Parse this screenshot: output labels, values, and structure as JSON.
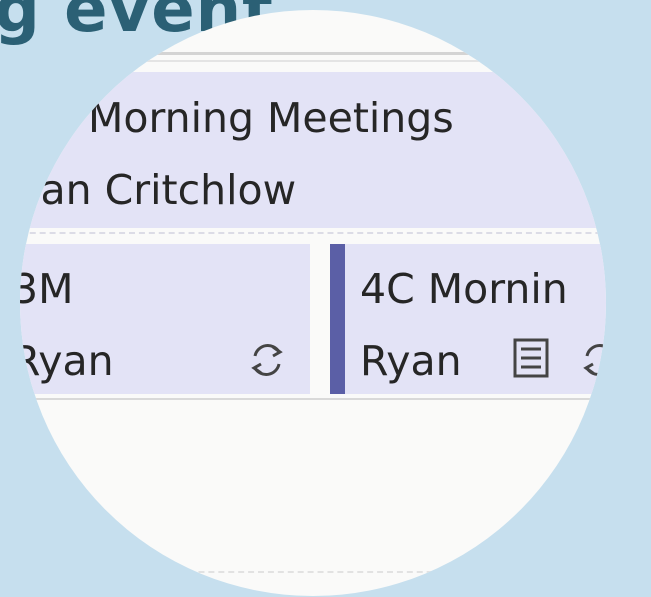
{
  "page": {
    "heading": "g event"
  },
  "calendar": {
    "top_event": {
      "title": "Morning Meetings",
      "organizer": "Ryan Critchlow"
    },
    "left_event": {
      "title": "3M",
      "organizer": "Ryan",
      "icon": "recurring-icon"
    },
    "right_event": {
      "title": "4C Mornin",
      "organizer": "Ryan",
      "icons": [
        "notes-icon",
        "recurring-icon"
      ]
    }
  },
  "colors": {
    "background": "#c6dfee",
    "heading": "#2b6075",
    "event_fill": "#e3e3f6",
    "event_accent": "#5b5fa6"
  }
}
